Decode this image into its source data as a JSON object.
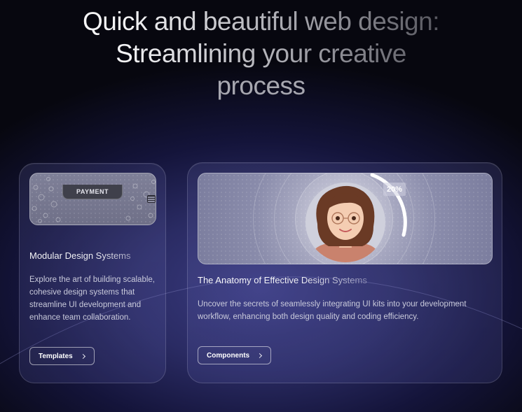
{
  "hero": {
    "line1": "Quick and beautiful web design:",
    "line2": "Streamlining your creative",
    "line3": "process"
  },
  "cards": [
    {
      "media_label": "PAYMENT",
      "title": "Modular Design Systems",
      "description": "Explore the art of building scalable, cohesive design systems that streamline UI development and enhance team collaboration.",
      "button": "Templates"
    },
    {
      "progress_label": "20%",
      "progress": 0.2,
      "title": "The Anatomy of Effective Design Systems",
      "description": "Uncover the secrets of seamlessly integrating UI kits into your development workflow, enhancing both design quality and coding efficiency.",
      "button": "Components"
    }
  ],
  "icons": [
    "chevron-right-icon",
    "card-chip-icon",
    "avatar-illustration"
  ],
  "colors": {
    "background_dark": "#050508",
    "background_glow": "#3b3c82",
    "card_border": "rgba(255,255,255,0.16)",
    "text_muted": "#c9cadb"
  }
}
